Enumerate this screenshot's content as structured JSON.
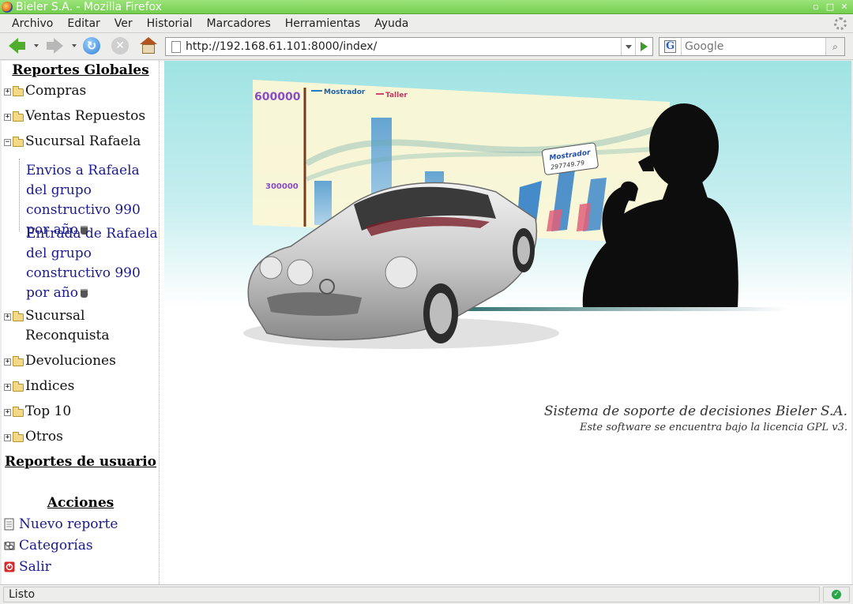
{
  "window": {
    "title": "Bieler S.A. - Mozilla Firefox",
    "controls": [
      "minimize-icon",
      "maximize-icon",
      "close-icon"
    ]
  },
  "menubar": {
    "items": [
      "Archivo",
      "Editar",
      "Ver",
      "Historial",
      "Marcadores",
      "Herramientas",
      "Ayuda"
    ]
  },
  "navbar": {
    "url": "http://192.168.61.101:8000/index/",
    "search_placeholder": "Google",
    "search_engine_letter": "G"
  },
  "sidebar": {
    "global_heading": "Reportes Globales",
    "tree": [
      {
        "label": "Compras",
        "expanded": false
      },
      {
        "label": "Ventas Repuestos",
        "expanded": false
      },
      {
        "label": "Sucursal Rafaela",
        "expanded": true,
        "children": [
          "Envios a Rafaela del grupo constructivo 990 por año",
          "Entrada de Rafaela del grupo constructivo 990 por año"
        ]
      },
      {
        "label": "Sucursal Reconquista",
        "expanded": false
      },
      {
        "label": "Devoluciones",
        "expanded": false
      },
      {
        "label": "Indices",
        "expanded": false
      },
      {
        "label": "Top 10",
        "expanded": false
      },
      {
        "label": "Otros",
        "expanded": false
      }
    ],
    "user_heading": "Reportes de usuario",
    "actions_heading": "Acciones",
    "actions": [
      {
        "label": "Nuevo reporte",
        "icon": "new-document-icon"
      },
      {
        "label": "Categorías",
        "icon": "categories-icon"
      },
      {
        "label": "Salir",
        "icon": "exit-icon"
      }
    ]
  },
  "banner": {
    "chart_legend": [
      "Mostrador",
      "Taller"
    ],
    "chart_ticks": [
      "600000",
      "300000"
    ],
    "callout_title": "Mostrador",
    "callout_value": "297749.79"
  },
  "footer_text": {
    "line1": "Sistema de soporte de decisiones Bieler S.A.",
    "line2": "Este software se encuentra bajo la licencia GPL v3."
  },
  "statusbar": {
    "text": "Listo"
  },
  "colors": {
    "titlebar": "#74cf4f",
    "link": "#1a1a8c",
    "banner_sky": "#9fe3e3"
  }
}
